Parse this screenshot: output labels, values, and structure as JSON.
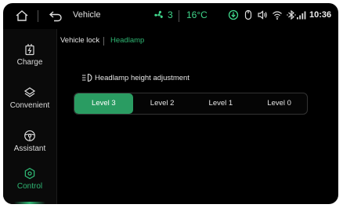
{
  "status_bar": {
    "title": "Vehicle",
    "fan_level": "3",
    "temperature": "16°C",
    "time": "10:36"
  },
  "sidebar": {
    "items": [
      {
        "label": "Charge",
        "icon": "charge-icon"
      },
      {
        "label": "Convenient",
        "icon": "convenient-icon"
      },
      {
        "label": "Assistant",
        "icon": "steering-wheel-icon"
      },
      {
        "label": "Control",
        "icon": "control-icon",
        "active": true
      }
    ]
  },
  "tabs": [
    {
      "label": "Vehicle lock",
      "active": false
    },
    {
      "label": "Headlamp",
      "active": true
    }
  ],
  "section": {
    "title": "Headlamp height adjustment",
    "icon": "headlamp-icon"
  },
  "headlamp_levels": {
    "options": [
      "Level 3",
      "Level 2",
      "Level 1",
      "Level 0"
    ],
    "selected": "Level 3"
  },
  "colors": {
    "accent": "#2fb673",
    "selected_bg": "#2a9c62",
    "background": "#000000"
  }
}
